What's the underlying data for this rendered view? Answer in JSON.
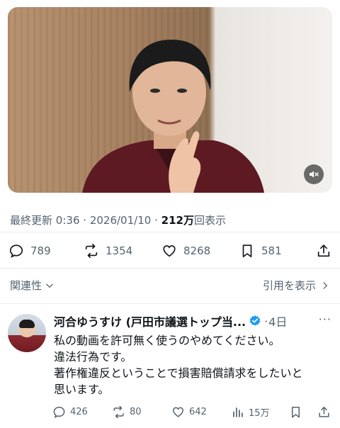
{
  "video": {
    "mute_icon": "speaker-muted-icon"
  },
  "meta": {
    "last_updated_label": "最終更新",
    "time": "0:36",
    "sep1": "·",
    "date": "2026/01/10",
    "sep2": "·",
    "views_count": "212万",
    "views_label": "回表示"
  },
  "actions": {
    "replies": "789",
    "reposts": "1354",
    "likes": "8268",
    "bookmarks": "581"
  },
  "related": {
    "label": "関連性",
    "quotes_label": "引用を表示"
  },
  "reply": {
    "author": "河合ゆうすけ (戸田市議選トップ当...",
    "time": "4日",
    "more": "···",
    "lines": [
      "私の動画を許可無く使うのやめてください。",
      "違法行為です。",
      "著作権違反ということで損害賠償請求をしたいと",
      "思います。"
    ],
    "stats": {
      "replies": "426",
      "reposts": "80",
      "likes": "642",
      "views": "15万"
    }
  },
  "colors": {
    "text_primary": "#0f1419",
    "text_secondary": "#536471",
    "verified_blue": "#1d9bf0"
  }
}
